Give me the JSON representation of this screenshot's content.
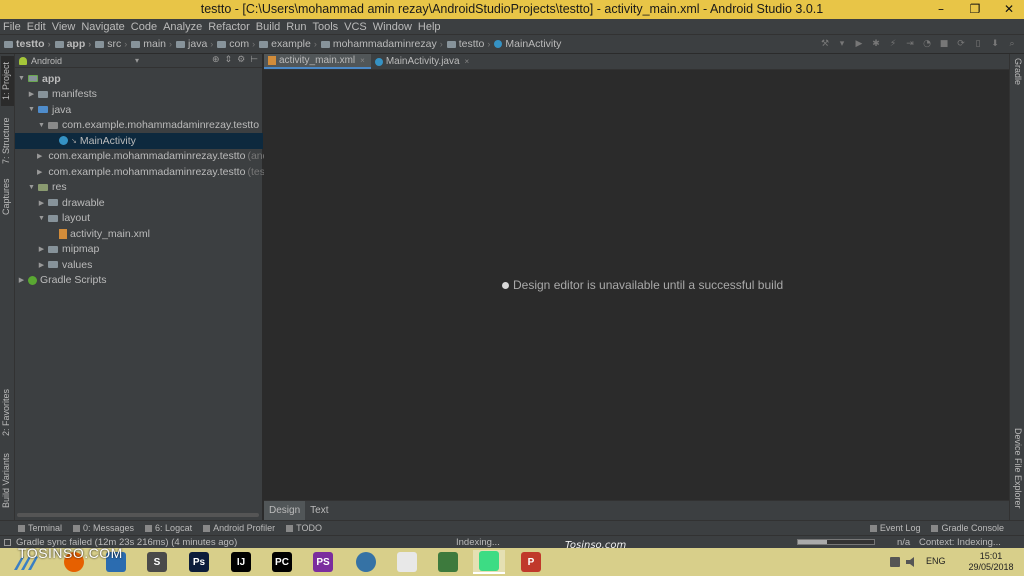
{
  "window": {
    "title": "testto - [C:\\Users\\mohammad amin rezay\\AndroidStudioProjects\\testto] - activity_main.xml - Android Studio 3.0.1",
    "minimize": "–",
    "maximize": "❐",
    "close": "✕"
  },
  "menu": [
    "File",
    "Edit",
    "View",
    "Navigate",
    "Code",
    "Analyze",
    "Refactor",
    "Build",
    "Run",
    "Tools",
    "VCS",
    "Window",
    "Help"
  ],
  "breadcrumbs": [
    "testto",
    "app",
    "src",
    "main",
    "java",
    "com",
    "example",
    "mohammadaminrezay",
    "testto",
    "MainActivity"
  ],
  "left_tool_tabs": [
    "1: Project",
    "7: Structure",
    "Captures",
    "2: Favorites",
    "Build Variants"
  ],
  "right_tool_tabs": [
    "Gradle",
    "Device File Explorer"
  ],
  "project_panel": {
    "view_mode": "Android",
    "tree": [
      {
        "label": "app",
        "depth": 0,
        "expanded": true,
        "icon": "app-module-icon"
      },
      {
        "label": "manifests",
        "depth": 1,
        "expanded": false,
        "icon": "folder-icon"
      },
      {
        "label": "java",
        "depth": 1,
        "expanded": true,
        "icon": "java-folder-icon"
      },
      {
        "label": "com.example.mohammadaminrezay.testto",
        "depth": 2,
        "expanded": true,
        "icon": "package-icon"
      },
      {
        "label": "MainActivity",
        "depth": 3,
        "selected": true,
        "icon": "class-icon"
      },
      {
        "label": "com.example.mohammadaminrezay.testto",
        "suffix": "(andr",
        "depth": 2,
        "expanded": false,
        "icon": "package-icon"
      },
      {
        "label": "com.example.mohammadaminrezay.testto",
        "suffix": "(test)",
        "depth": 2,
        "expanded": false,
        "icon": "package-icon"
      },
      {
        "label": "res",
        "depth": 1,
        "expanded": true,
        "icon": "res-folder-icon"
      },
      {
        "label": "drawable",
        "depth": 2,
        "expanded": false,
        "icon": "folder-icon"
      },
      {
        "label": "layout",
        "depth": 2,
        "expanded": true,
        "icon": "folder-icon"
      },
      {
        "label": "activity_main.xml",
        "depth": 3,
        "icon": "xml-file-icon"
      },
      {
        "label": "mipmap",
        "depth": 2,
        "expanded": false,
        "icon": "folder-icon"
      },
      {
        "label": "values",
        "depth": 2,
        "expanded": false,
        "icon": "folder-icon"
      },
      {
        "label": "Gradle Scripts",
        "depth": 0,
        "expanded": false,
        "icon": "gradle-icon"
      }
    ]
  },
  "editor": {
    "tabs": [
      {
        "label": "activity_main.xml",
        "active": true,
        "icon": "xml-file-icon"
      },
      {
        "label": "MainActivity.java",
        "active": false,
        "icon": "class-icon"
      }
    ],
    "message": "Design editor is unavailable until a successful build",
    "bottom_tabs": [
      {
        "label": "Design",
        "active": true
      },
      {
        "label": "Text",
        "active": false
      }
    ]
  },
  "bottom_tools": [
    {
      "label": "Terminal",
      "icon": "terminal-icon"
    },
    {
      "label": "0: Messages",
      "icon": "messages-icon"
    },
    {
      "label": "6: Logcat",
      "icon": "logcat-icon"
    },
    {
      "label": "Android Profiler",
      "icon": "profiler-icon"
    },
    {
      "label": "TODO",
      "icon": "todo-icon"
    }
  ],
  "bottom_tools_right": [
    {
      "label": "Event Log",
      "icon": "event-log-icon"
    },
    {
      "label": "Gradle Console",
      "icon": "gradle-console-icon"
    }
  ],
  "status": {
    "message": "Gradle sync failed (12m 23s 216ms) (4 minutes ago)",
    "task": "Indexing...",
    "progress": 0.38,
    "position": "n/a",
    "context": "Context: Indexing..."
  },
  "taskbar": {
    "apps": [
      {
        "name": "firefox-icon",
        "color": "#e66000",
        "text": ""
      },
      {
        "name": "app-icon",
        "color": "#2b6cb0",
        "text": ""
      },
      {
        "name": "sublime-text-icon",
        "color": "#4a4a4a",
        "text": "S"
      },
      {
        "name": "photoshop-icon",
        "color": "#0c1c3a",
        "text": "Ps"
      },
      {
        "name": "intellij-icon",
        "color": "#000000",
        "text": "IJ"
      },
      {
        "name": "pycharm-icon",
        "color": "#000000",
        "text": "PC"
      },
      {
        "name": "phpstorm-icon",
        "color": "#7b2d9e",
        "text": "PS"
      },
      {
        "name": "python-icon",
        "color": "#3572a5",
        "text": ""
      },
      {
        "name": "app-icon-2",
        "color": "#e8e8e8",
        "text": ""
      },
      {
        "name": "app-icon-3",
        "color": "#3d7a3d",
        "text": ""
      },
      {
        "name": "android-studio-icon",
        "color": "#3ddc84",
        "text": ""
      },
      {
        "name": "psiphon-icon",
        "color": "#c0392b",
        "text": "P"
      }
    ],
    "language": "ENG",
    "time": "15:01",
    "date": "29/05/2018"
  },
  "watermark": {
    "left": "TOSINSO.COM",
    "center": "Tosinso.com"
  },
  "colors": {
    "titlebar": "#e8c547",
    "ide_bg": "#2b2b2b",
    "panel_bg": "#3c3f41",
    "selection": "#0d293e",
    "accent": "#4a88c7"
  }
}
